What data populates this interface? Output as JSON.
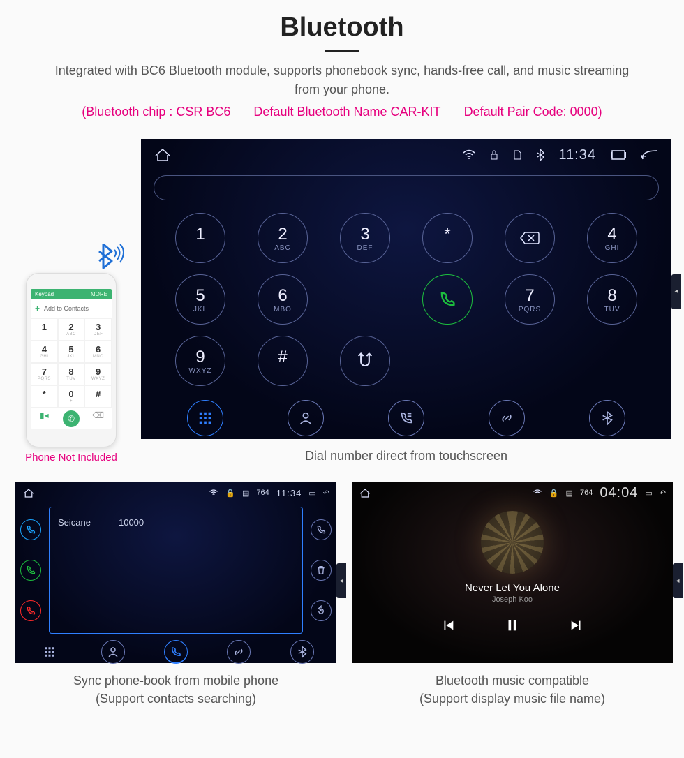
{
  "header": {
    "title": "Bluetooth",
    "subtitle": "Integrated with BC6 Bluetooth module, supports phonebook sync, hands-free call, and music streaming from your phone.",
    "chip": "(Bluetooth chip : CSR BC6",
    "name": "Default Bluetooth Name CAR-KIT",
    "pair": "Default Pair Code: 0000)"
  },
  "phone": {
    "caption": "Phone Not Included",
    "top_left": "Keypad",
    "top_right": "MORE",
    "add": "Add to Contacts",
    "keys": [
      {
        "d": "1",
        "l": ""
      },
      {
        "d": "2",
        "l": "ABC"
      },
      {
        "d": "3",
        "l": "DEF"
      },
      {
        "d": "4",
        "l": "GHI"
      },
      {
        "d": "5",
        "l": "JKL"
      },
      {
        "d": "6",
        "l": "MNO"
      },
      {
        "d": "7",
        "l": "PQRS"
      },
      {
        "d": "8",
        "l": "TUV"
      },
      {
        "d": "9",
        "l": "WXYZ"
      },
      {
        "d": "*",
        "l": ""
      },
      {
        "d": "0",
        "l": "+"
      },
      {
        "d": "#",
        "l": ""
      }
    ]
  },
  "main_screen": {
    "time": "11:34",
    "caption": "Dial number direct from touchscreen",
    "keys": [
      {
        "d": "1",
        "l": ""
      },
      {
        "d": "2",
        "l": "ABC"
      },
      {
        "d": "3",
        "l": "DEF"
      },
      {
        "d": "*",
        "l": ""
      },
      {
        "icon": "backspace"
      },
      {
        "d": "4",
        "l": "GHI"
      },
      {
        "d": "5",
        "l": "JKL"
      },
      {
        "d": "6",
        "l": "MBO"
      },
      {
        "icon": "spacer"
      },
      {
        "icon": "call"
      },
      {
        "d": "7",
        "l": "PQRS"
      },
      {
        "d": "8",
        "l": "TUV"
      },
      {
        "d": "9",
        "l": "WXYZ"
      },
      {
        "d": "#",
        "l": ""
      },
      {
        "icon": "swap"
      }
    ]
  },
  "phonebook_screen": {
    "time": "11:34",
    "contact_name": "Seicane",
    "contact_number": "10000",
    "caption_l1": "Sync phone-book from mobile phone",
    "caption_l2": "(Support contacts searching)"
  },
  "music_screen": {
    "time": "04:04",
    "track": "Never Let You Alone",
    "artist": "Joseph Koo",
    "caption_l1": "Bluetooth music compatible",
    "caption_l2": "(Support display music file name)"
  }
}
